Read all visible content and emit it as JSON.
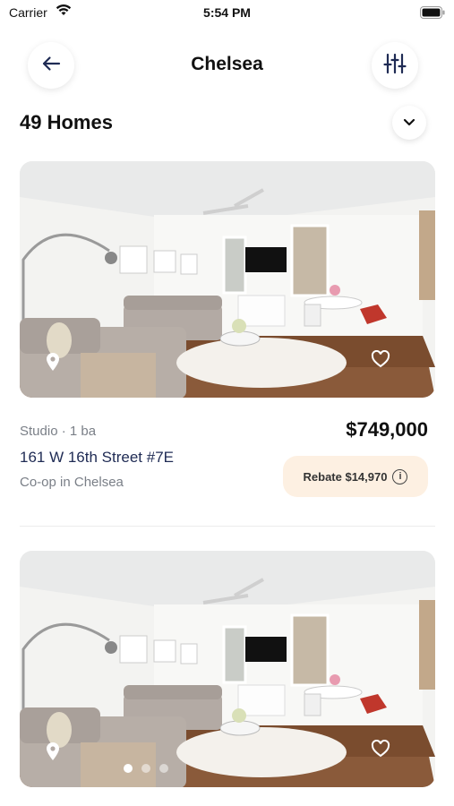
{
  "status_bar": {
    "carrier": "Carrier",
    "time": "5:54 PM"
  },
  "header": {
    "title": "Chelsea",
    "back_icon": "arrow-left-icon",
    "filter_icon": "sliders-icon"
  },
  "results": {
    "count_label": "49 Homes",
    "sort_icon": "chevron-down-icon"
  },
  "listings": [
    {
      "beds_baths": "Studio · 1 ba",
      "address": "161 W 16th Street #7E",
      "type": "Co-op in Chelsea",
      "price": "$749,000",
      "rebate": "Rebate $14,970",
      "photo_count_active": 1
    },
    {
      "photo_count_active": 1
    }
  ],
  "colors": {
    "accent_text": "#1f2b54",
    "rebate_bg": "#fdf0e2",
    "muted": "#7a7f87"
  }
}
